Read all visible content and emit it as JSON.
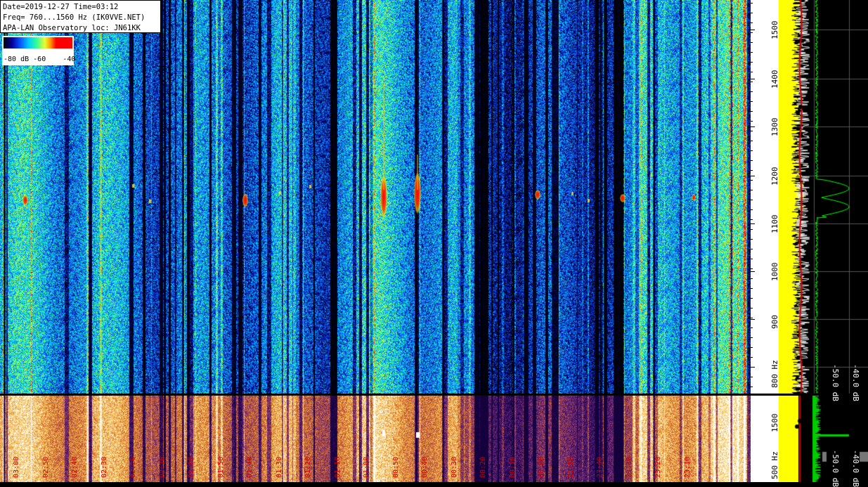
{
  "info": {
    "line1": "Date=2019-12-27 Time=03:12",
    "line2": "Freq= 760...1560 Hz (IK0VVE.NET)",
    "line3": "APA-LAN Observatory loc: JN61KK"
  },
  "colorbar": {
    "label_min": "-80 dB",
    "label_mid": "-60",
    "label_max": "-40"
  },
  "freq_axis": {
    "ticks": [
      "1500",
      "1400",
      "1300",
      "1200",
      "1100",
      "1000",
      "900",
      "800 Hz"
    ],
    "lower_ticks": [
      "1500",
      "500 Hz"
    ]
  },
  "spectrum": {
    "db_labels": [
      "-50.0 dB",
      "-40.0 dB"
    ],
    "db_labels_low": [
      "-50.0 dB",
      "-40.0 dB"
    ]
  },
  "time_labels": [
    "03:00",
    "02:50",
    "02:40",
    "02:30",
    "02:20",
    "02:10",
    "02:00",
    "01:50",
    "01:40",
    "01:30",
    "01:20",
    "01:10",
    "01:00",
    "00:50",
    "00:40",
    "00:30",
    "00:20",
    "00:10",
    "00:00",
    "23:50",
    "23:40",
    "23:30",
    "23:20",
    "23:10"
  ],
  "colors": {
    "waterfall_base": "#1a5f9a",
    "signal": "#ff0000",
    "spectrum_fill": "#ffff00",
    "spectrum_line": "#00ff00",
    "marker_line": "#cc0000"
  }
}
